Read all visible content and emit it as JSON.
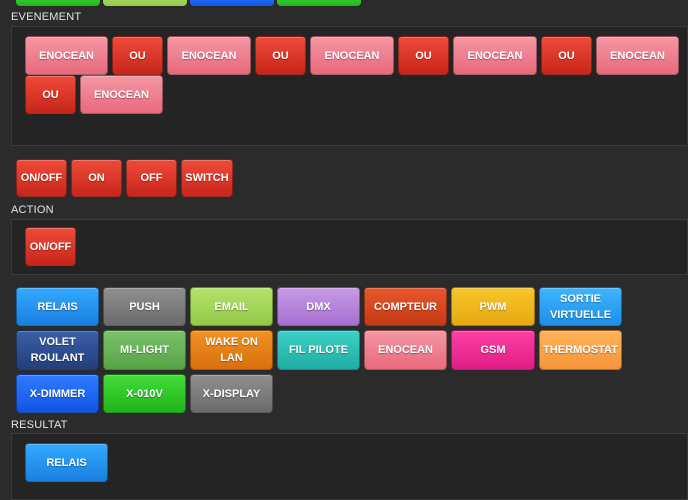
{
  "sections": {
    "evenement": "EVENEMENT",
    "action": "ACTION",
    "resultat": "RESULTAT"
  },
  "event_items": [
    {
      "label": "ENOCEAN",
      "color": "#ee7d8e"
    },
    {
      "label": "OU",
      "color": "#d3352a"
    },
    {
      "label": "ENOCEAN",
      "color": "#ee7d8e"
    },
    {
      "label": "OU",
      "color": "#d3352a"
    },
    {
      "label": "ENOCEAN",
      "color": "#ee7d8e"
    },
    {
      "label": "OU",
      "color": "#d3352a"
    },
    {
      "label": "ENOCEAN",
      "color": "#ee7d8e"
    },
    {
      "label": "OU",
      "color": "#d3352a"
    },
    {
      "label": "ENOCEAN",
      "color": "#ee7d8e"
    },
    {
      "label": "OU",
      "color": "#d3352a"
    },
    {
      "label": "ENOCEAN",
      "color": "#ee7d8e"
    }
  ],
  "action_options": [
    {
      "label": "ON/OFF"
    },
    {
      "label": "ON"
    },
    {
      "label": "OFF"
    },
    {
      "label": "SWITCH"
    }
  ],
  "action_selected": {
    "label": "ON/OFF"
  },
  "device_palette": [
    {
      "label": "RELAIS",
      "color": "#2a95f4"
    },
    {
      "label": "PUSH",
      "color": "#7d7d7d"
    },
    {
      "label": "EMAIL",
      "color": "#a5d65a"
    },
    {
      "label": "DMX",
      "color": "#b886db"
    },
    {
      "label": "COMPTEUR",
      "color": "#d64820"
    },
    {
      "label": "PWM",
      "color": "#efb81e"
    },
    {
      "label": "SORTIE VIRTUELLE",
      "color": "#2aa2f3"
    },
    {
      "label": "VOLET ROULANT",
      "color": "#2e4f90"
    },
    {
      "label": "MI-LIGHT",
      "color": "#69b358"
    },
    {
      "label": "WAKE ON LAN",
      "color": "#e5811a"
    },
    {
      "label": "FIL PILOTE",
      "color": "#2ebeb4"
    },
    {
      "label": "ENOCEAN",
      "color": "#ee7d8e"
    },
    {
      "label": "GSM",
      "color": "#f02e94"
    },
    {
      "label": "THERMOSTAT",
      "color": "#faa44a"
    },
    {
      "label": "X-DIMMER",
      "color": "#2068f2"
    },
    {
      "label": "X-010V",
      "color": "#32c82a"
    },
    {
      "label": "X-DISPLAY",
      "color": "#7d7d7d"
    }
  ],
  "result_items": [
    {
      "label": "RELAIS",
      "color": "#2a95f4"
    }
  ]
}
